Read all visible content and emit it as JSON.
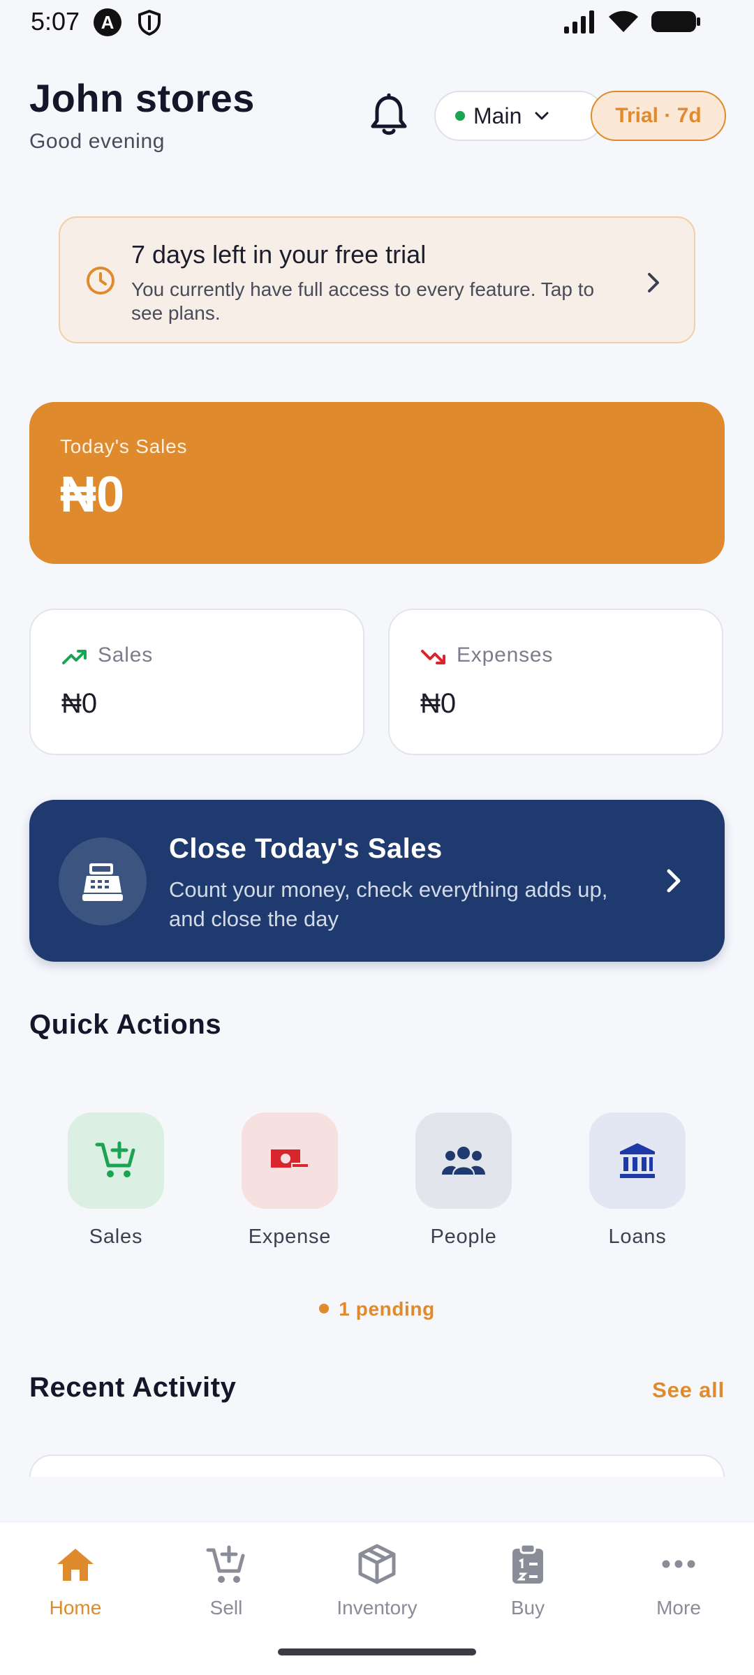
{
  "status_bar": {
    "time": "5:07",
    "left_badge": "A"
  },
  "header": {
    "store_name": "John stores",
    "greeting": "Good evening",
    "branch": "Main",
    "trial_badge": "Trial · 7d"
  },
  "trial_banner": {
    "title": "7 days left in your free trial",
    "description": "You currently have full access to every feature. Tap to see plans."
  },
  "today_sales": {
    "label": "Today's Sales",
    "value": "₦0"
  },
  "stats": {
    "sales": {
      "label": "Sales",
      "value": "₦0"
    },
    "expenses": {
      "label": "Expenses",
      "value": "₦0"
    }
  },
  "close_sales": {
    "title": "Close Today's Sales",
    "description": "Count your money, check everything adds up, and close the day"
  },
  "quick_actions": {
    "title": "Quick Actions",
    "items": [
      {
        "label": "Sales",
        "icon": "cart-add-icon"
      },
      {
        "label": "Expense",
        "icon": "money-minus-icon"
      },
      {
        "label": "People",
        "icon": "people-icon"
      },
      {
        "label": "Loans",
        "icon": "bank-icon"
      }
    ],
    "pending": "1 pending"
  },
  "recent_activity": {
    "title": "Recent Activity",
    "see_all": "See all"
  },
  "bottom_nav": [
    {
      "label": "Home",
      "icon": "home-icon",
      "active": true
    },
    {
      "label": "Sell",
      "icon": "cart-add-icon"
    },
    {
      "label": "Inventory",
      "icon": "box-icon"
    },
    {
      "label": "Buy",
      "icon": "clipboard-icon"
    },
    {
      "label": "More",
      "icon": "more-dots-icon"
    }
  ],
  "colors": {
    "accent_orange": "#e08a2e",
    "navy": "#1e3a6e",
    "success_green": "#1aa350",
    "danger_red": "#d9262c",
    "background": "#f6f7fb"
  }
}
